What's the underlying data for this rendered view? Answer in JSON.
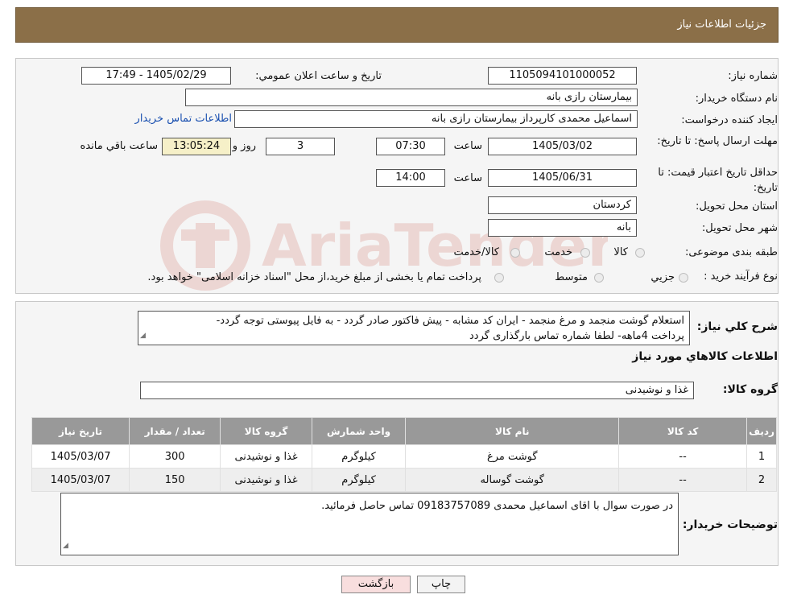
{
  "header": {
    "title": "جزئیات اطلاعات نیاز"
  },
  "info": {
    "need_number_label": "شماره نیاز:",
    "need_number": "1105094101000052",
    "announce_label": "تاریخ و ساعت اعلان عمومي:",
    "announce_value": "1405/02/29 - 17:49",
    "buyer_org_label": "نام دستگاه خریدار:",
    "buyer_org": "بیمارستان رازی بانه",
    "requester_label": "ایجاد کننده درخواست:",
    "requester": "اسماعیل محمدی کارپرداز بیمارستان رازی بانه",
    "contact_link": "اطلاعات تماس خریدار",
    "reply_deadline_label": "مهلت ارسال پاسخ: تا تاریخ:",
    "reply_date": "1405/03/02",
    "time_label": "ساعت",
    "reply_time": "07:30",
    "days_value": "3",
    "days_label": "روز و",
    "remaining_time": "13:05:24",
    "remaining_label": "ساعت باقي مانده",
    "price_validity_label": "حداقل تاریخ اعتبار قیمت: تا تاریخ:",
    "validity_date": "1405/06/31",
    "validity_time": "14:00",
    "province_label": "استان محل تحویل:",
    "province": "کردستان",
    "city_label": "شهر محل تحویل:",
    "city": "بانه",
    "category_label": "طبقه بندی موضوعی:",
    "category_options": [
      "کالا",
      "خدمت",
      "کالا/خدمت"
    ],
    "process_label": "نوع فرآیند خرید :",
    "process_options": [
      "جزیي",
      "متوسط"
    ],
    "process_note": "پرداخت تمام یا بخشی از مبلغ خرید،از محل \"اسناد خزانه اسلامی\" خواهد بود."
  },
  "watermark_text": "AriaTender.neT",
  "description": {
    "label": "شرح كلي نياز:",
    "line1": "استعلام گوشت منجمد و مرغ منجمد - ایران کد مشابه - پیش فاکتور صادر گردد - به فایل پیوستی توجه گردد-",
    "line2": "پرداخت 4ماهه- لطفا شماره تماس بارگذاری گردد",
    "goods_info_title": "اطلاعات کالاهاي مورد نياز",
    "group_label": "گروه کالا:",
    "group_value": "غذا و نوشیدنی"
  },
  "table": {
    "headers": [
      "ردیف",
      "کد کالا",
      "نام کالا",
      "واحد شمارش",
      "گروه کالا",
      "تعداد / مقدار",
      "تاریخ نیاز"
    ],
    "rows": [
      [
        "1",
        "--",
        "گوشت مرغ",
        "کیلوگرم",
        "غذا و نوشیدنی",
        "300",
        "1405/03/07"
      ],
      [
        "2",
        "--",
        "گوشت گوساله",
        "کیلوگرم",
        "غذا و نوشیدنی",
        "150",
        "1405/03/07"
      ]
    ]
  },
  "buyer_notes": {
    "label": "توضیحات خریدار:",
    "text": "در صورت سوال با اقای  اسماعیل محمدی 09183757089 تماس حاصل فرمائید."
  },
  "buttons": {
    "print": "چاپ",
    "back": "بازگشت"
  },
  "colors": {
    "header_bg": "#8b6f48",
    "link": "#1a50b0",
    "back_button_bg": "#f8dede",
    "watermark": "#c0392b"
  }
}
